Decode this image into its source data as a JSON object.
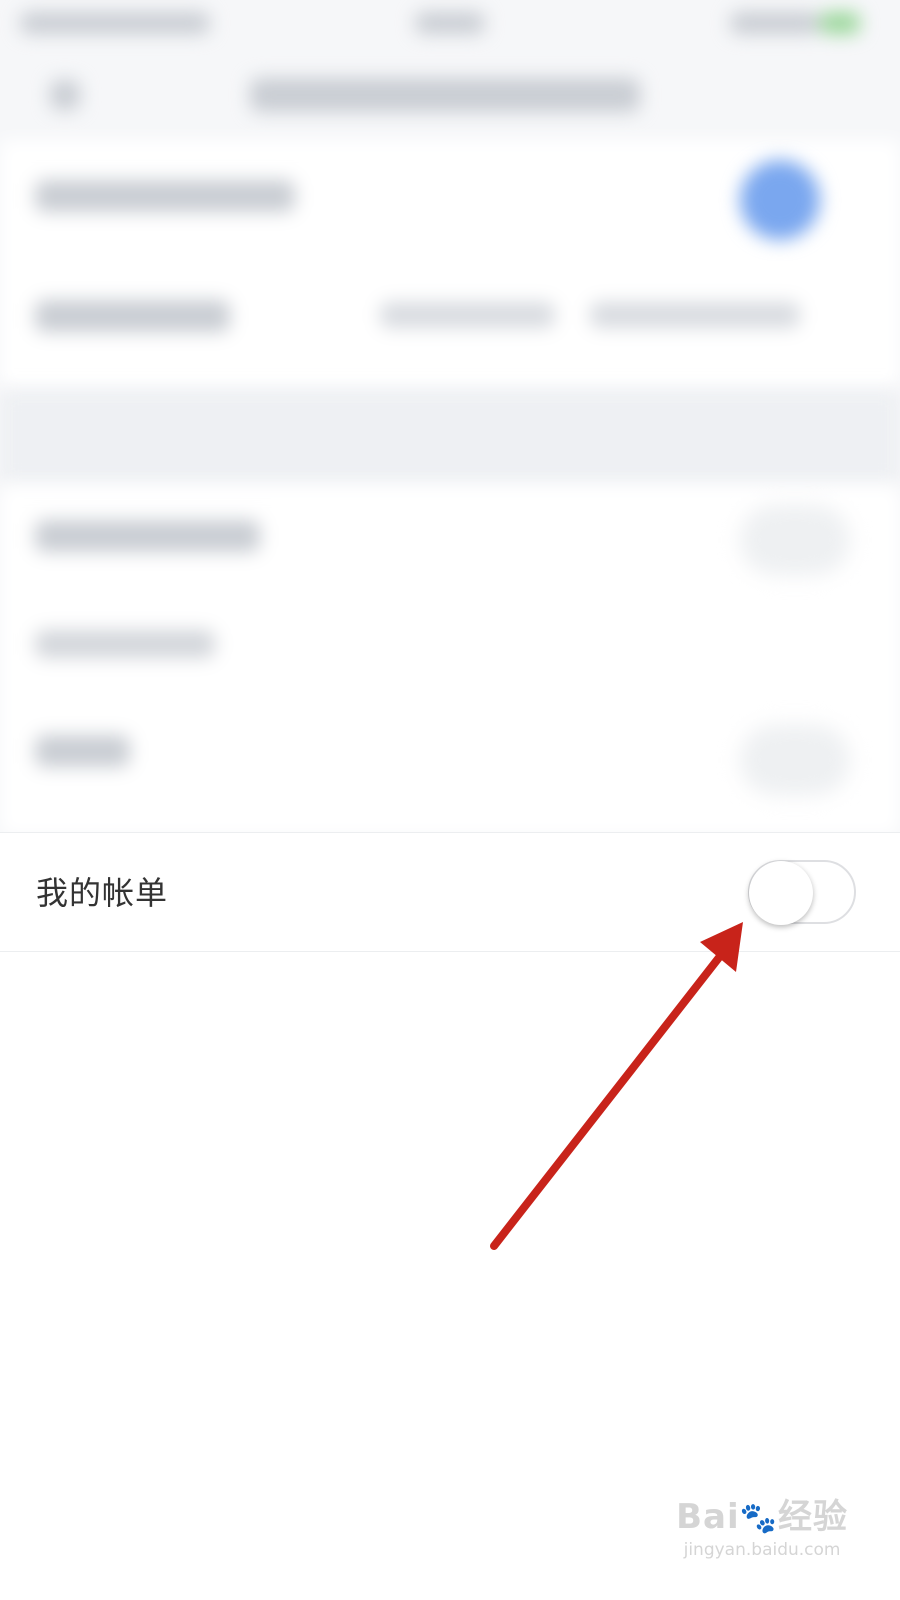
{
  "settings": {
    "bill_row": {
      "label": "我的帐单",
      "toggle_on": false
    }
  },
  "watermark": {
    "brand_left": "Bai",
    "brand_right": "经验",
    "url": "jingyan.baidu.com"
  },
  "colors": {
    "arrow": "#c8231a",
    "toggle_border": "#dedfe2",
    "blurred_avatar": "#7aa7ef"
  }
}
